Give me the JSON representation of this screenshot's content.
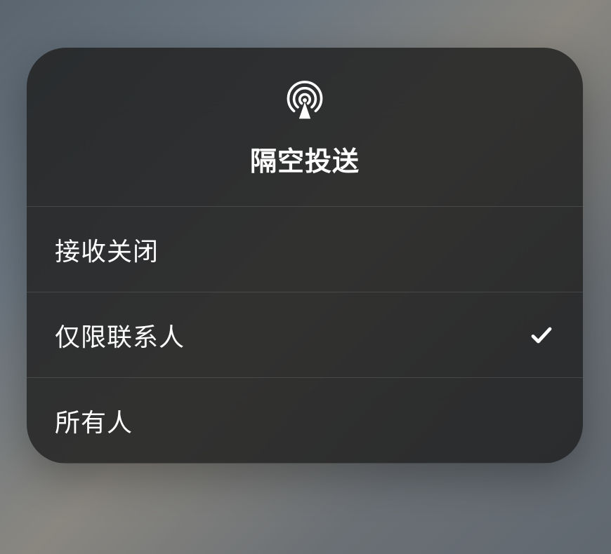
{
  "popup": {
    "title": "隔空投送",
    "icon": "airdrop-icon",
    "options": [
      {
        "label": "接收关闭",
        "selected": false
      },
      {
        "label": "仅限联系人",
        "selected": true
      },
      {
        "label": "所有人",
        "selected": false
      }
    ]
  }
}
